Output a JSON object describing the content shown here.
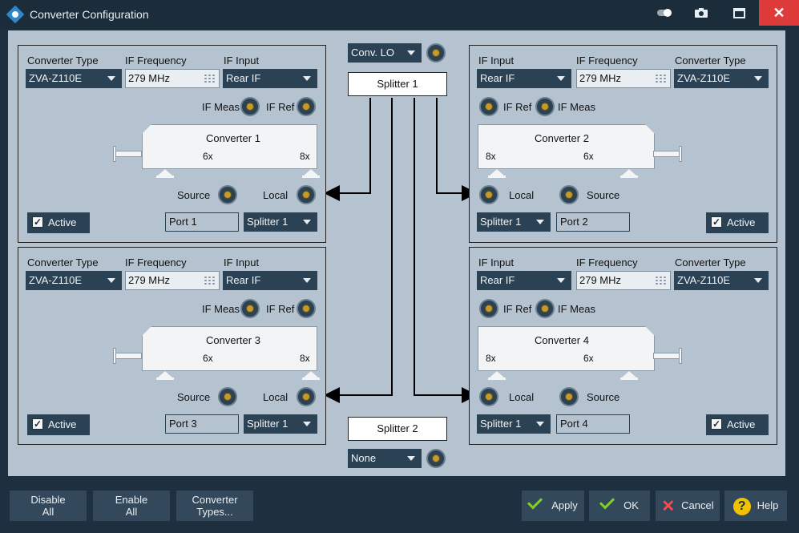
{
  "window": {
    "title": "Converter Configuration",
    "close_glyph": "✕"
  },
  "colors": {
    "panel_bg": "#b4c3cf",
    "control_dark": "#2b4254",
    "titlebar": "#1b2c3b",
    "close_red": "#e03b3b",
    "connector_gold": "#c49a2c"
  },
  "labels": {
    "converter_type": "Converter Type",
    "if_frequency": "IF Frequency",
    "if_input": "IF Input",
    "if_meas": "IF Meas",
    "if_ref": "IF Ref",
    "source": "Source",
    "local": "Local",
    "active": "Active"
  },
  "lo": {
    "conv_lo_value": "Conv. LO",
    "splitter1": "Splitter 1",
    "splitter2": "Splitter 2",
    "splitter2_select": "None"
  },
  "converters": [
    {
      "title": "Converter 1",
      "type": "ZVA-Z110E",
      "if_freq": "279 MHz",
      "if_input": "Rear IF",
      "left_mult": "6x",
      "right_mult": "8x",
      "port": "Port 1",
      "splitter": "Splitter 1",
      "active": true
    },
    {
      "title": "Converter 2",
      "type": "ZVA-Z110E",
      "if_freq": "279 MHz",
      "if_input": "Rear IF",
      "left_mult": "8x",
      "right_mult": "6x",
      "port": "Port 2",
      "splitter": "Splitter 1",
      "active": true
    },
    {
      "title": "Converter 3",
      "type": "ZVA-Z110E",
      "if_freq": "279 MHz",
      "if_input": "Rear IF",
      "left_mult": "6x",
      "right_mult": "8x",
      "port": "Port 3",
      "splitter": "Splitter 1",
      "active": true
    },
    {
      "title": "Converter 4",
      "type": "ZVA-Z110E",
      "if_freq": "279 MHz",
      "if_input": "Rear IF",
      "left_mult": "8x",
      "right_mult": "6x",
      "port": "Port 4",
      "splitter": "Splitter 1",
      "active": true
    }
  ],
  "buttons": {
    "disable_all_1": "Disable",
    "disable_all_2": "All",
    "enable_all_1": "Enable",
    "enable_all_2": "All",
    "conv_types_1": "Converter",
    "conv_types_2": "Types...",
    "apply": "Apply",
    "ok": "OK",
    "cancel": "Cancel",
    "help": "Help"
  }
}
